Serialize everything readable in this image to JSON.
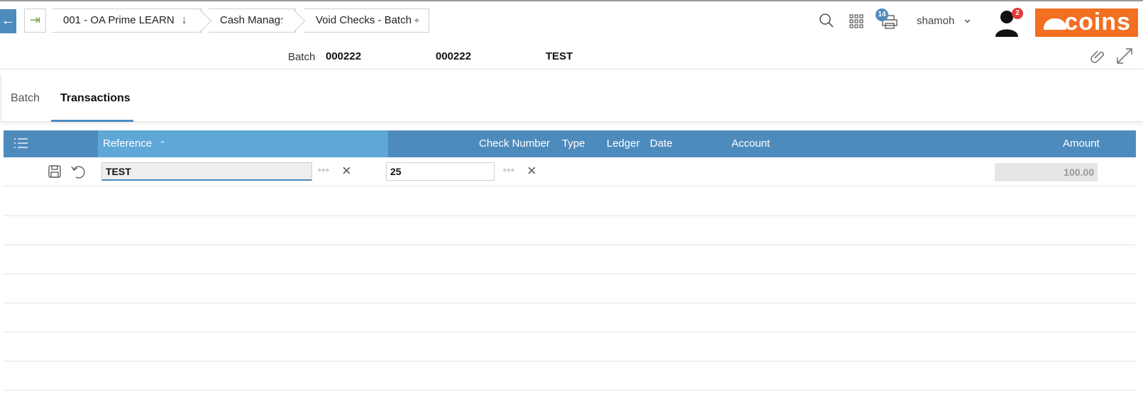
{
  "breadcrumbs": [
    {
      "label": "001 - OA Prime LEARN"
    },
    {
      "label": "Cash Manager"
    },
    {
      "label": "Void Checks - Batch"
    }
  ],
  "top_icons": {
    "print_badge": "14",
    "notification_badge": "2"
  },
  "user": {
    "name": "shamoh"
  },
  "brand": {
    "logo_text": "coins",
    "color": "#f36f21"
  },
  "header": {
    "label": "Batch",
    "values": [
      "000222",
      "000222",
      "TEST"
    ]
  },
  "tabs": [
    {
      "label": "Batch",
      "active": false
    },
    {
      "label": "Transactions",
      "active": true
    }
  ],
  "grid": {
    "columns": [
      "Reference",
      "Check Number",
      "Type",
      "Ledger",
      "Date",
      "Account",
      "Amount"
    ],
    "edit_row": {
      "reference": "TEST",
      "check_number": "25",
      "amount": "100.00"
    }
  },
  "colors": {
    "accent": "#4e8bbd",
    "header_sorted": "#5fa7d6"
  }
}
